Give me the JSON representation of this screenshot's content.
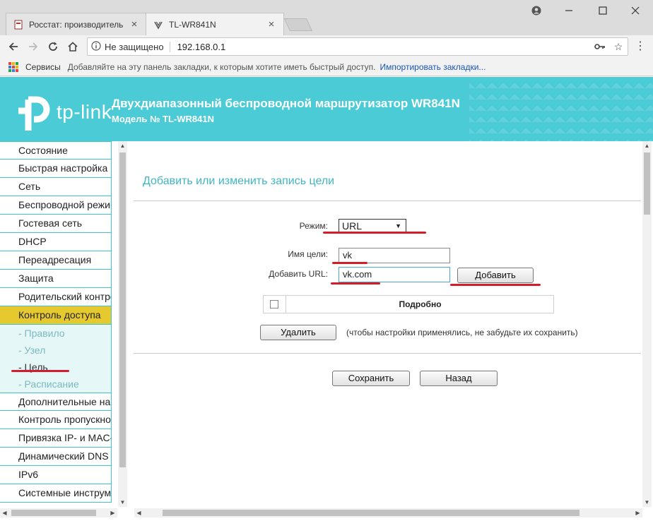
{
  "browser": {
    "tabs": [
      {
        "title": "Росстат: производитель",
        "active": false
      },
      {
        "title": "TL-WR841N",
        "active": true
      }
    ],
    "security_label": "Не защищено",
    "url": "192.168.0.1",
    "bookmarks": {
      "services": "Сервисы",
      "hint": "Добавляйте на эту панель закладки, к которым хотите иметь быстрый доступ.",
      "import": "Импортировать закладки..."
    }
  },
  "header": {
    "logo": "tp-link",
    "title": "Двухдиапазонный беспроводной маршрутизатор WR841N",
    "model": "Модель № TL-WR841N"
  },
  "sidebar": {
    "items": [
      {
        "label": "Состояние"
      },
      {
        "label": "Быстрая настройка"
      },
      {
        "label": "Сеть"
      },
      {
        "label": "Беспроводной режим"
      },
      {
        "label": "Гостевая сеть"
      },
      {
        "label": "DHCP"
      },
      {
        "label": "Переадресация"
      },
      {
        "label": "Защита"
      },
      {
        "label": "Родительский контроль"
      },
      {
        "label": "Контроль доступа",
        "active": true
      }
    ],
    "subitems": [
      {
        "label": "- Правило"
      },
      {
        "label": "- Узел"
      },
      {
        "label": "- Цель",
        "current": true
      },
      {
        "label": "- Расписание"
      }
    ],
    "items_after": [
      {
        "label": "Дополнительные настройки"
      },
      {
        "label": "Контроль пропускной способности"
      },
      {
        "label": "Привязка IP- и MAC-адресов"
      },
      {
        "label": "Динамический DNS"
      },
      {
        "label": "IPv6"
      },
      {
        "label": "Системные инструменты"
      }
    ]
  },
  "form": {
    "title": "Добавить или изменить запись цели",
    "mode_label": "Режим:",
    "mode_value": "URL",
    "target_name_label": "Имя цели:",
    "target_name_value": "vk",
    "add_url_label": "Добавить URL:",
    "add_url_value": "vk.com",
    "add_button": "Добавить",
    "table_header": "Подробно",
    "delete_button": "Удалить",
    "note": "(чтобы настройки применялись, не забудьте их сохранить)",
    "save_button": "Сохранить",
    "back_button": "Назад"
  },
  "colors": {
    "brand": "#4acbd6",
    "active_menu": "#e6c92f",
    "annotation": "#d21e2a"
  }
}
